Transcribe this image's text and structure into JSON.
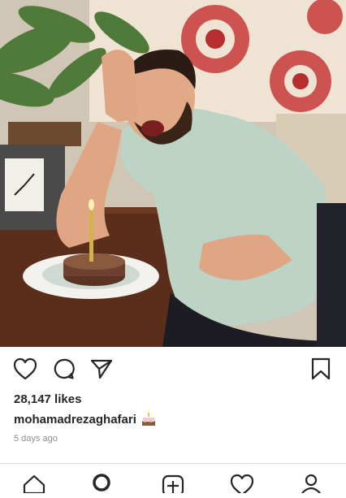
{
  "post": {
    "image_alt": "Man laughing beside a birthday cake with a candle",
    "likes": "28,147 likes",
    "username": "mohamadrezaghafari",
    "caption_emoji": "birthday-cake-icon",
    "timestamp": "5 days ago"
  },
  "actions": {
    "like_icon": "heart-icon",
    "comment_icon": "comment-icon",
    "share_icon": "paper-plane-icon",
    "save_icon": "bookmark-icon"
  },
  "bottom_nav": {
    "items": [
      "home-icon",
      "search-icon",
      "add-post-icon",
      "activity-heart-icon",
      "profile-icon"
    ]
  },
  "colors": {
    "text": "#262626",
    "muted": "#8e8e8e",
    "divider": "#dbdbdb"
  }
}
